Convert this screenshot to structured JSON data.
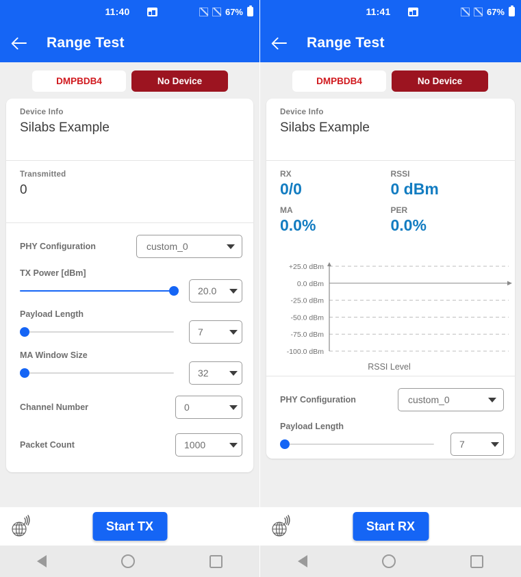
{
  "colors": {
    "primary": "#1565f5",
    "accent_red": "#d0191e",
    "dark_red": "#9c1420",
    "stat_blue": "#127cc1",
    "page_bg": "#efefef"
  },
  "left": {
    "statusbar": {
      "time": "11:40",
      "battery_percent": "67%",
      "image_icon": "image-icon",
      "signal_icons": [
        "no-signal-icon",
        "no-signal-icon"
      ],
      "battery_icon": "battery-icon"
    },
    "appbar": {
      "back_icon": "back-arrow-icon",
      "title": "Range Test"
    },
    "tabs": {
      "device": "DMPBDB4",
      "no_device": "No Device"
    },
    "device_info": {
      "label": "Device Info",
      "value": "Silabs Example"
    },
    "transmitted": {
      "label": "Transmitted",
      "value": "0"
    },
    "settings": {
      "phy": {
        "label": "PHY Configuration",
        "value": "custom_0"
      },
      "tx_power": {
        "label": "TX Power [dBm]",
        "value": "20.0",
        "slider_percent": 100
      },
      "payload": {
        "label": "Payload Length",
        "value": "7",
        "slider_percent": 0
      },
      "ma_window": {
        "label": "MA Window Size",
        "value": "32",
        "slider_percent": 0
      },
      "channel": {
        "label": "Channel Number",
        "value": "0"
      },
      "packet_count": {
        "label": "Packet Count",
        "value": "1000"
      }
    },
    "bottom": {
      "globe_icon": "globe-signal-icon",
      "action": "Start TX"
    },
    "nav": {
      "back": "nav-back-icon",
      "home": "nav-home-icon",
      "recents": "nav-recents-icon"
    }
  },
  "right": {
    "statusbar": {
      "time": "11:41",
      "battery_percent": "67%"
    },
    "appbar": {
      "title": "Range Test"
    },
    "tabs": {
      "device": "DMPBDB4",
      "no_device": "No Device"
    },
    "device_info": {
      "label": "Device Info",
      "value": "Silabs Example"
    },
    "stats": [
      {
        "label": "RX",
        "value": "0/0"
      },
      {
        "label": "RSSI",
        "value": "0 dBm"
      },
      {
        "label": "MA",
        "value": "0.0%"
      },
      {
        "label": "PER",
        "value": "0.0%"
      }
    ],
    "settings": {
      "phy": {
        "label": "PHY Configuration",
        "value": "custom_0"
      },
      "payload": {
        "label": "Payload Length",
        "value": "7",
        "slider_percent": 0
      }
    },
    "bottom": {
      "globe_icon": "globe-signal-icon",
      "action": "Start RX"
    }
  },
  "chart_data": {
    "type": "line",
    "title": "",
    "xlabel": "RSSI Level",
    "ylabel": "",
    "ylim": [
      -100,
      25
    ],
    "ytick_labels": [
      "+25.0 dBm",
      "0.0 dBm",
      "-25.0 dBm",
      "-50.0 dBm",
      "-75.0 dBm",
      "-100.0 dBm"
    ],
    "ytick_values": [
      25,
      0,
      -25,
      -50,
      -75,
      -100
    ],
    "grid": true,
    "grid_style": "dashed",
    "zero_axis_value": 0,
    "legend": [],
    "series": [
      {
        "name": "RSSI Level",
        "x": [],
        "values": []
      }
    ]
  }
}
